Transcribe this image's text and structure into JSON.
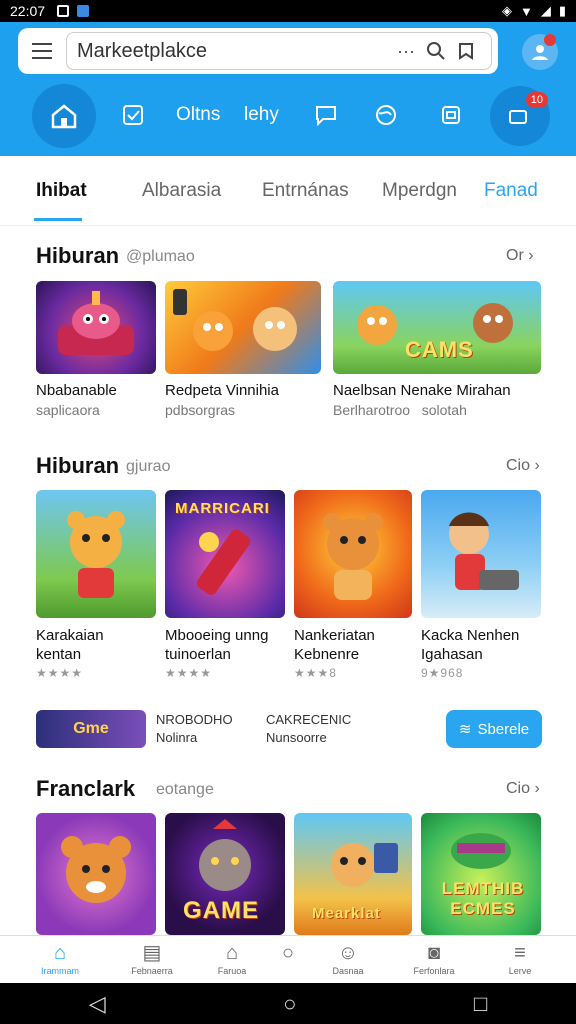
{
  "status": {
    "time": "22:07"
  },
  "search": {
    "value": "Markeetplakce"
  },
  "nav": {
    "item1": "Oltns",
    "item2": "lehy",
    "badge": "10"
  },
  "tabs": [
    "Ihibat",
    "Albarasia",
    "Entrnánas",
    "Mperdgn",
    "Fanad"
  ],
  "section1": {
    "title": "Hiburan",
    "sub": "@plumao",
    "more": "Or",
    "cards": [
      {
        "title": "Nbabanable",
        "sub": "saplicaora"
      },
      {
        "title": "Redpeta Vinnihia",
        "sub": "pdbsorgras"
      },
      {
        "title": "Naelbsan Nenake Mirahan",
        "sub": "Berlharotroo   solotah",
        "art": "CAMS"
      }
    ]
  },
  "section2": {
    "title": "Hiburan",
    "sub": "gjurao",
    "more": "Cio",
    "cards": [
      {
        "title": "Karakaian",
        "title2": "kentan",
        "stars": "★★★★"
      },
      {
        "title": "Mbooeing unng",
        "title2": "tuinoerlan",
        "stars": "★★★★",
        "art": "MARRICARI"
      },
      {
        "title": "Nankeriatan",
        "title2": "Kebnenre",
        "stars": "★★★8"
      },
      {
        "title": "Kacka Nenhen",
        "title2": "Igahasan",
        "stars": "9★968"
      }
    ]
  },
  "promo": {
    "art": "Gme",
    "line1a": "NROBODHO",
    "line1b": "Nolinra",
    "line2a": "CAKRECENIC",
    "line2b": "Nunsoorre",
    "button": "Sberele"
  },
  "section3": {
    "title": "Franclark",
    "sub": "eotange",
    "more": "Cio",
    "cards": [
      {
        "art": ""
      },
      {
        "art": "GAME"
      },
      {
        "art": "Mearklat"
      },
      {
        "art": "LEMTHIB ECMES"
      }
    ]
  },
  "bottomnav": [
    "Irammam",
    "Febnaerra",
    "Faruoa",
    "",
    "Dasnaa",
    "Ferfonlara",
    "Lerve"
  ]
}
